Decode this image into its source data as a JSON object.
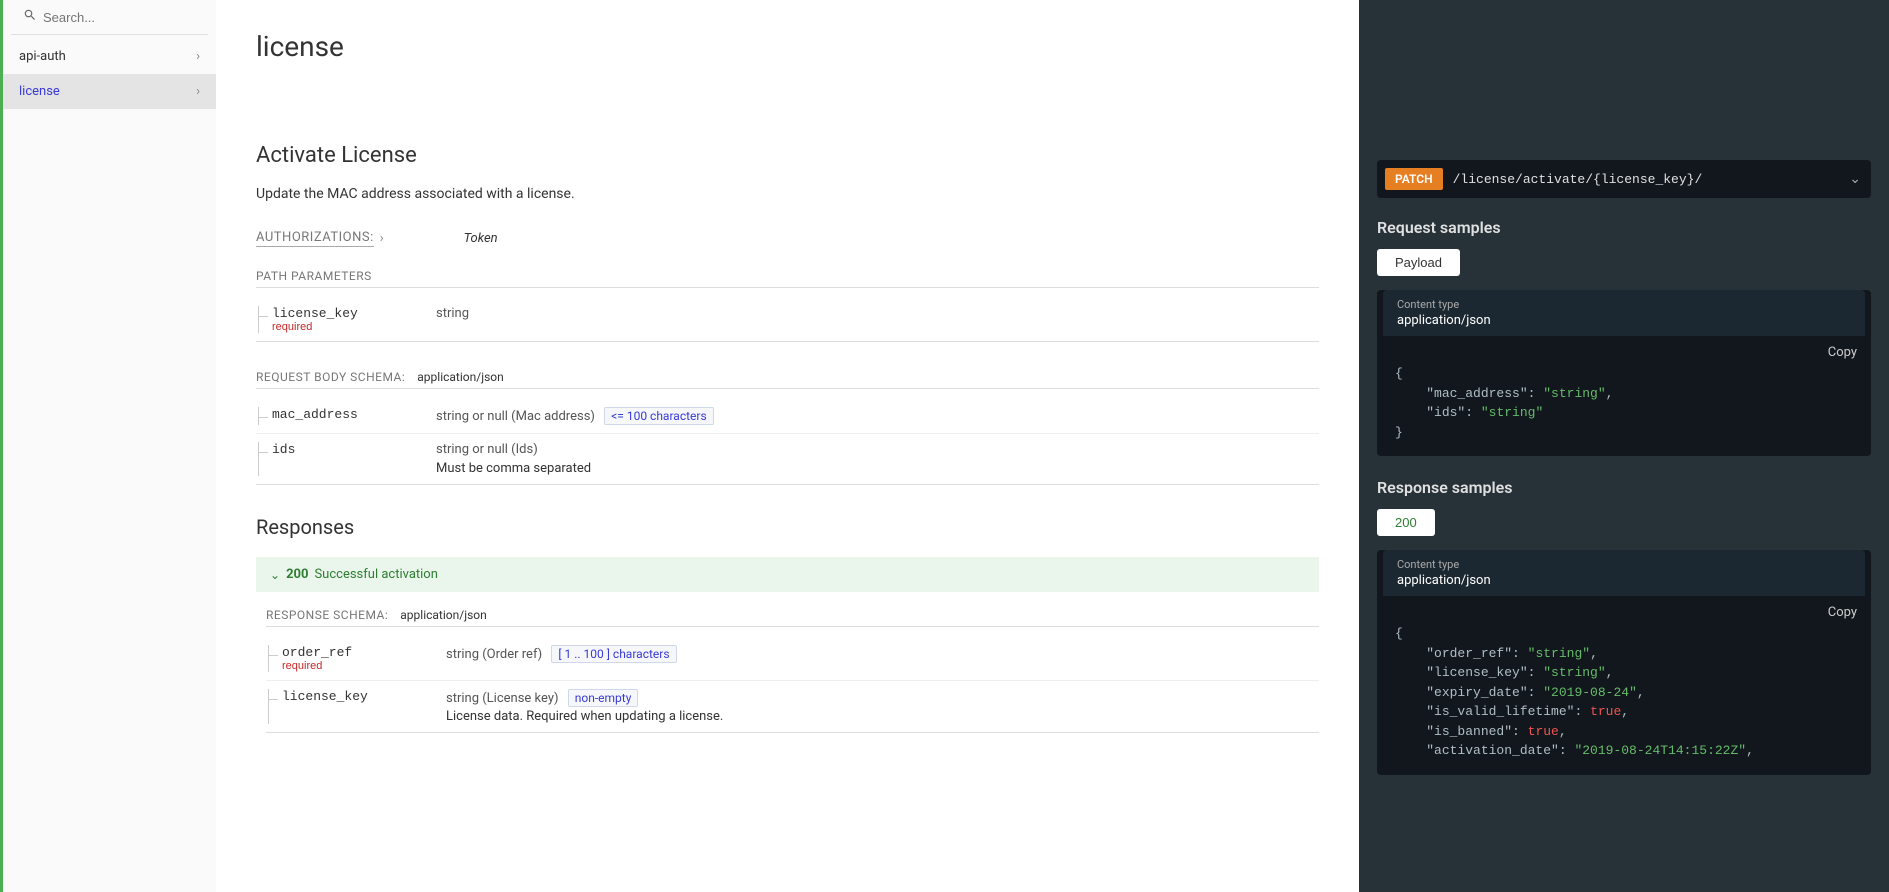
{
  "sidebar": {
    "search_placeholder": "Search...",
    "items": [
      {
        "label": "api-auth",
        "active": false
      },
      {
        "label": "license",
        "active": true
      }
    ]
  },
  "page": {
    "title": "license",
    "op_title": "Activate License",
    "op_desc": "Update the MAC address associated with a license.",
    "authorizations_label": "AUTHORIZATIONS:",
    "auth_value": "Token",
    "path_params_label": "PATH PARAMETERS",
    "path_params": [
      {
        "name": "license_key",
        "required_label": "required",
        "type": "string"
      }
    ],
    "request_body_label": "REQUEST BODY SCHEMA:",
    "request_body_ct": "application/json",
    "request_body_fields": [
      {
        "name": "mac_address",
        "type": "string or null (Mac address)",
        "constraint": "<= 100 characters",
        "desc": ""
      },
      {
        "name": "ids",
        "type": "string or null (Ids)",
        "constraint": "",
        "desc": "Must be comma separated"
      }
    ],
    "responses_label": "Responses",
    "response_status": "200",
    "response_status_text": "Successful activation",
    "response_schema_label": "RESPONSE SCHEMA:",
    "response_schema_ct": "application/json",
    "response_fields": [
      {
        "name": "order_ref",
        "required_label": "required",
        "type": "string (Order ref)",
        "constraint": "[ 1 .. 100 ] characters",
        "desc": ""
      },
      {
        "name": "license_key",
        "type": "string (License key)",
        "constraint": "non-empty",
        "desc": "License data. Required when updating a license."
      }
    ]
  },
  "rightpanel": {
    "method": "PATCH",
    "path": "/license/activate/{license_key}/",
    "request_samples_label": "Request samples",
    "payload_tab": "Payload",
    "content_type_label": "Content type",
    "content_type_value": "application/json",
    "copy_label": "Copy",
    "request_payload": {
      "mac_address": "string",
      "ids": "string"
    },
    "response_samples_label": "Response samples",
    "response_tab": "200",
    "response_payload": {
      "order_ref": "string",
      "license_key": "string",
      "expiry_date": "2019-08-24",
      "is_valid_lifetime": true,
      "is_banned": true,
      "activation_date": "2019-08-24T14:15:22Z"
    }
  }
}
